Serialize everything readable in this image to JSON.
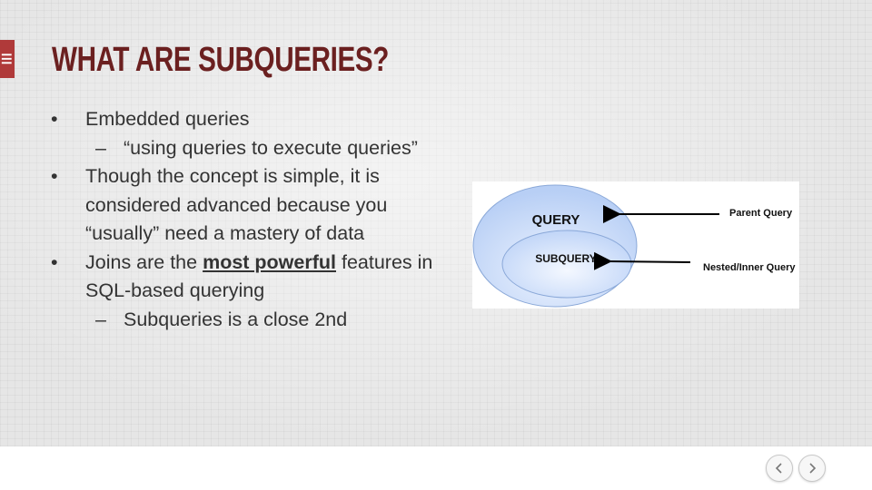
{
  "slide": {
    "title": "What are Subqueries?",
    "menu_icon": "hamburger-icon",
    "bullets": [
      {
        "level": 1,
        "marker": "•",
        "text": "Embedded queries"
      },
      {
        "level": 2,
        "marker": "–",
        "text": "“using queries to execute queries”"
      },
      {
        "level": 1,
        "marker": "•",
        "text": "Though the concept is simple, it is considered advanced because you “usually” need a mastery of data"
      },
      {
        "level": 1,
        "marker": "•",
        "prefix": "Joins are the ",
        "strong": "most powerful",
        "suffix": " features in SQL-based querying"
      },
      {
        "level": 2,
        "marker": "–",
        "text": "Subqueries is a close 2nd"
      }
    ]
  },
  "diagram": {
    "outer_label": "QUERY",
    "inner_label": "SUBQUERY",
    "parent_label": "Parent Query",
    "nested_label": "Nested/Inner Query"
  },
  "nav": {
    "prev_icon": "chevron-left-icon",
    "next_icon": "chevron-right-icon"
  },
  "colors": {
    "title": "#6b2020",
    "accent_tab": "#b03a3a",
    "text": "#333333"
  }
}
